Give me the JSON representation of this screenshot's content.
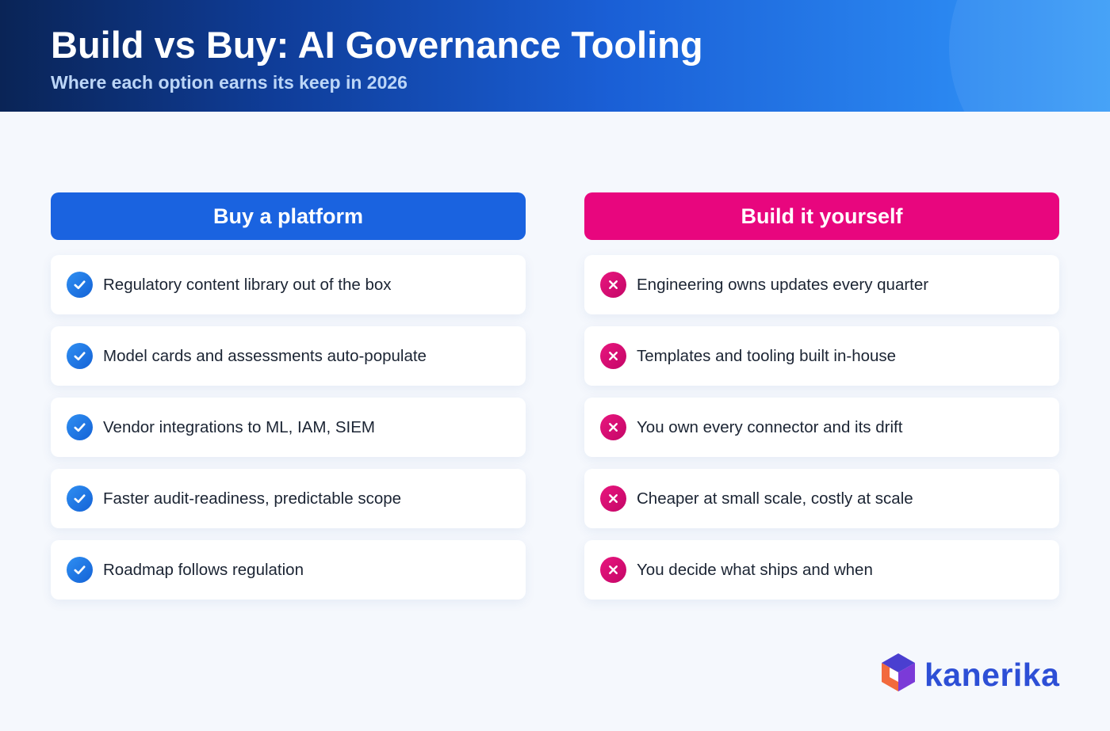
{
  "header": {
    "title": "Build vs Buy: AI Governance Tooling",
    "subtitle": "Where each option earns its keep in 2026"
  },
  "columns": [
    {
      "title": "Buy a platform",
      "icon": "check-icon",
      "color": "#1a63e0",
      "items": [
        "Regulatory content library out of the box",
        "Model cards and assessments auto-populate",
        "Vendor integrations to ML, IAM, SIEM",
        "Faster audit-readiness, predictable scope",
        "Roadmap follows regulation"
      ]
    },
    {
      "title": "Build it yourself",
      "icon": "x-icon",
      "color": "#e8067e",
      "items": [
        "Engineering owns updates every quarter",
        "Templates and tooling built in-house",
        "You own every connector and its drift",
        "Cheaper at small scale, costly at scale",
        "You decide what ships and when"
      ]
    }
  ],
  "logo": {
    "text": "kanerika",
    "icon": "kanerika-cube-logo-icon",
    "color": "#2d4fd6"
  }
}
